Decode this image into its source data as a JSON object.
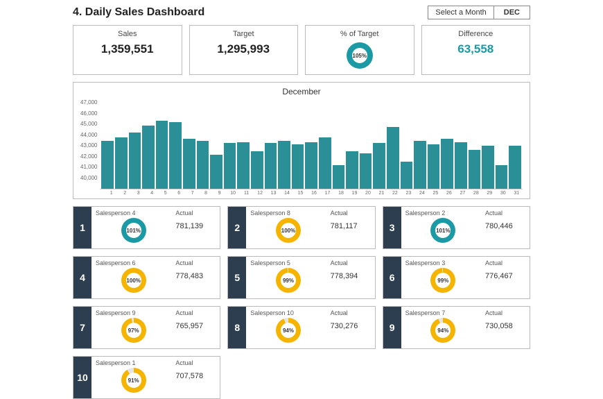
{
  "title": "4. Daily Sales Dashboard",
  "month_selector": {
    "label": "Select a Month",
    "value": "DEC"
  },
  "kpis": {
    "sales": {
      "label": "Sales",
      "value": "1,359,551"
    },
    "target": {
      "label": "Target",
      "value": "1,295,993"
    },
    "pct": {
      "label": "% of Target",
      "value": "105%",
      "pct": 105,
      "color": "#1b9aa6"
    },
    "difference": {
      "label": "Difference",
      "value": "63,558"
    }
  },
  "chart_data": {
    "type": "bar",
    "title": "December",
    "xlabel": "",
    "ylabel": "",
    "ylim": [
      40000,
      47000
    ],
    "yticks": [
      "47,000",
      "46,000",
      "45,000",
      "44,000",
      "43,000",
      "42,000",
      "41,000",
      "40,000"
    ],
    "categories": [
      1,
      2,
      3,
      4,
      5,
      6,
      7,
      8,
      9,
      10,
      11,
      12,
      13,
      14,
      15,
      16,
      17,
      18,
      19,
      20,
      21,
      22,
      23,
      24,
      25,
      26,
      27,
      28,
      29,
      30,
      31
    ],
    "values": [
      44100,
      44400,
      44800,
      45400,
      45800,
      45700,
      44300,
      44100,
      42900,
      43900,
      44000,
      43200,
      43900,
      44100,
      43800,
      44000,
      44400,
      42000,
      43200,
      43000,
      43900,
      45300,
      42300,
      44100,
      43800,
      44300,
      44000,
      43300,
      43700,
      42000,
      43700
    ]
  },
  "salespeople": [
    {
      "rank": 1,
      "name": "Salesperson 4",
      "actual_label": "Actual",
      "actual": "781,139",
      "pct": 101,
      "color": "#1b9aa6"
    },
    {
      "rank": 2,
      "name": "Salesperson 8",
      "actual_label": "Actual",
      "actual": "781,117",
      "pct": 100,
      "color": "#f4b400"
    },
    {
      "rank": 3,
      "name": "Salesperson 2",
      "actual_label": "Actual",
      "actual": "780,446",
      "pct": 101,
      "color": "#1b9aa6"
    },
    {
      "rank": 4,
      "name": "Salesperson 6",
      "actual_label": "Actual",
      "actual": "778,483",
      "pct": 100,
      "color": "#f4b400"
    },
    {
      "rank": 5,
      "name": "Salesperson 5",
      "actual_label": "Actual",
      "actual": "778,394",
      "pct": 99,
      "color": "#f4b400"
    },
    {
      "rank": 6,
      "name": "Salesperson 3",
      "actual_label": "Actual",
      "actual": "776,467",
      "pct": 99,
      "color": "#f4b400"
    },
    {
      "rank": 7,
      "name": "Salesperson 9",
      "actual_label": "Actual",
      "actual": "765,957",
      "pct": 97,
      "color": "#f4b400"
    },
    {
      "rank": 8,
      "name": "Salesperson 10",
      "actual_label": "Actual",
      "actual": "730,276",
      "pct": 94,
      "color": "#f4b400"
    },
    {
      "rank": 9,
      "name": "Salesperson 7",
      "actual_label": "Actual",
      "actual": "730,058",
      "pct": 94,
      "color": "#f4b400"
    },
    {
      "rank": 10,
      "name": "Salesperson 1",
      "actual_label": "Actual",
      "actual": "707,578",
      "pct": 91,
      "color": "#f4b400"
    }
  ]
}
